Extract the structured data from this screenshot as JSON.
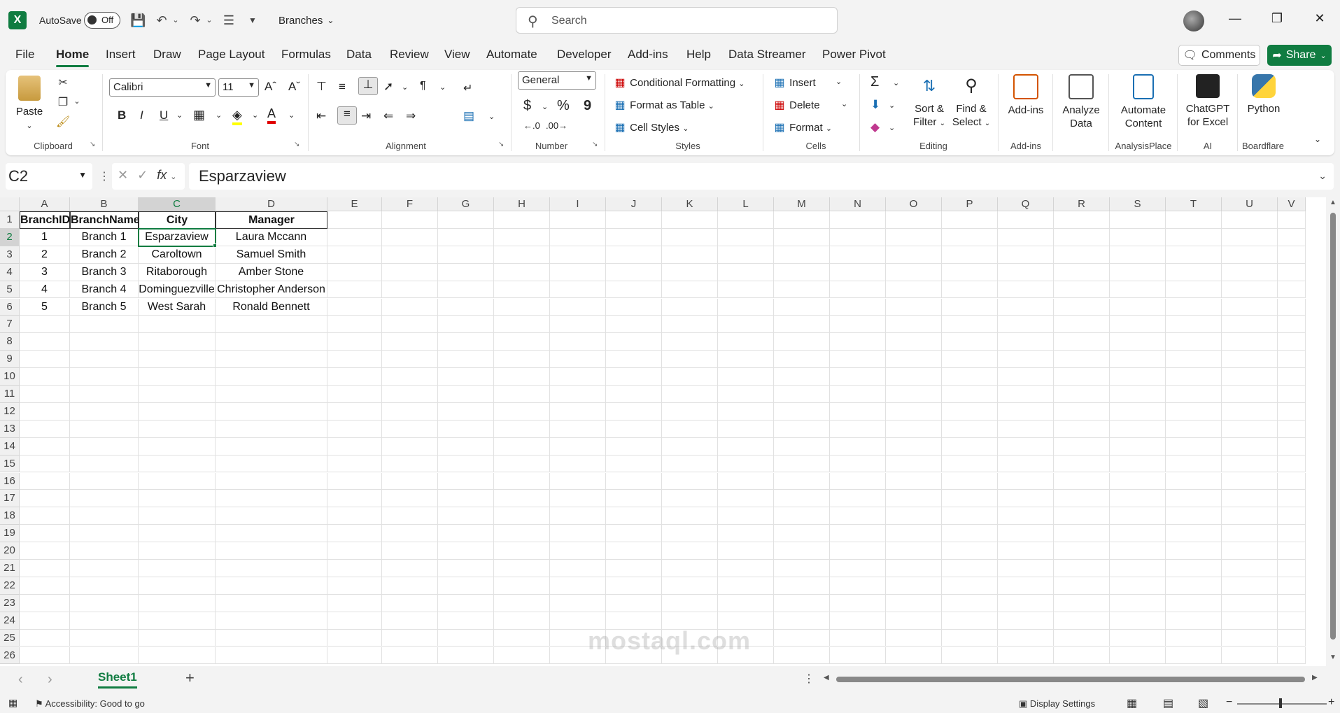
{
  "titlebar": {
    "app_icon": "X",
    "autosave_label": "AutoSave",
    "autosave_state": "Off",
    "filename": "Branches",
    "search_placeholder": "Search"
  },
  "tabs": [
    "File",
    "Home",
    "Insert",
    "Draw",
    "Page Layout",
    "Formulas",
    "Data",
    "Review",
    "View",
    "Automate",
    "Developer",
    "Add-ins",
    "Help",
    "Data Streamer",
    "Power Pivot"
  ],
  "active_tab": "Home",
  "comments_label": "Comments",
  "share_label": "Share",
  "ribbon": {
    "clipboard": {
      "paste": "Paste",
      "label": "Clipboard"
    },
    "font": {
      "name": "Calibri",
      "size": "11",
      "label": "Font",
      "bold": "B",
      "italic": "I",
      "underline": "U"
    },
    "alignment": {
      "label": "Alignment"
    },
    "number": {
      "format": "General",
      "label": "Number",
      "currency": "$",
      "percent": "%",
      "comma": "9"
    },
    "styles": {
      "conditional": "Conditional Formatting",
      "format_table": "Format as Table",
      "cell_styles": "Cell Styles",
      "label": "Styles"
    },
    "cells": {
      "insert": "Insert",
      "delete": "Delete",
      "format": "Format",
      "label": "Cells"
    },
    "editing": {
      "sort_1": "Sort &",
      "sort_2": "Filter",
      "find_1": "Find &",
      "find_2": "Select",
      "label": "Editing"
    },
    "addins": {
      "btn": "Add-ins",
      "label": "Add-ins"
    },
    "analyze": {
      "line1": "Analyze",
      "line2": "Data"
    },
    "automate": {
      "line1": "Automate",
      "line2": "Content",
      "label": "AnalysisPlace"
    },
    "chatgpt": {
      "line1": "ChatGPT",
      "line2": "for Excel",
      "label": "AI"
    },
    "python": {
      "line1": "Python",
      "label": "Boardflare"
    }
  },
  "formula_bar": {
    "name_box": "C2",
    "content": "Esparzaview",
    "fx": "fx"
  },
  "columns": [
    "A",
    "B",
    "C",
    "D",
    "E",
    "F",
    "G",
    "H",
    "I",
    "J",
    "K",
    "L",
    "M",
    "N",
    "O",
    "P",
    "Q",
    "R",
    "S",
    "T",
    "U",
    "V"
  ],
  "rows": [
    "1",
    "2",
    "3",
    "4",
    "5",
    "6",
    "7",
    "8",
    "9",
    "10",
    "11",
    "12",
    "13",
    "14",
    "15",
    "16",
    "17",
    "18",
    "19",
    "20",
    "21",
    "22",
    "23",
    "24",
    "25",
    "26"
  ],
  "table": {
    "headers": [
      "BranchID",
      "BranchName",
      "City",
      "Manager"
    ],
    "data": [
      [
        "1",
        "Branch 1",
        "Esparzaview",
        "Laura Mccann"
      ],
      [
        "2",
        "Branch 2",
        "Caroltown",
        "Samuel Smith"
      ],
      [
        "3",
        "Branch 3",
        "Ritaborough",
        "Amber Stone"
      ],
      [
        "4",
        "Branch 4",
        "Dominguezville",
        "Christopher Anderson"
      ],
      [
        "5",
        "Branch 5",
        "West Sarah",
        "Ronald Bennett"
      ]
    ]
  },
  "sheet": {
    "name": "Sheet1",
    "add": "+"
  },
  "status": {
    "accessibility": "Accessibility: Good to go",
    "display_settings": "Display Settings",
    "zoom_minus": "−",
    "zoom_plus": "+"
  },
  "watermark": "mostaql.com"
}
